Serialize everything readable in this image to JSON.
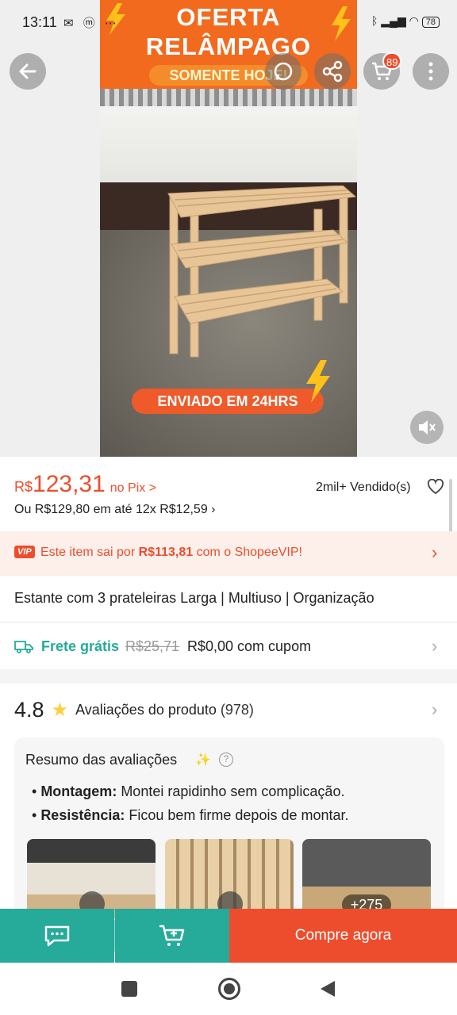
{
  "status_bar": {
    "time": "13:11",
    "battery": "78"
  },
  "media": {
    "banner_line1": "OFERTA",
    "banner_line2": "RELÂMPAGO",
    "banner_pill": "SOMENTE HOJE!",
    "shipping_tag": "ENVIADO EM 24HRS"
  },
  "header": {
    "cart_badge": "89"
  },
  "price": {
    "currency": "R$",
    "value": "123,31",
    "pix_label": "no Pix >",
    "installment": "Ou R$129,80 em até 12x R$12,59 ›",
    "sold": "2mil+ Vendido(s)"
  },
  "vip": {
    "tag": "VIP",
    "text_before": "Este item sai por ",
    "vip_price": "R$113,81",
    "text_after": " com o ShopeeVIP!"
  },
  "product": {
    "title": "Estante com 3 prateleiras Larga | Multiuso | Organização"
  },
  "shipping": {
    "label": "Frete grátis",
    "old_price": "R$25,71",
    "new_price": "R$0,00 com cupom"
  },
  "reviews": {
    "score": "4.8",
    "label": "Avaliações do produto",
    "count": "(978)",
    "summary_title": "Resumo das avaliações",
    "bullets": [
      {
        "key": "Montagem:",
        "text": " Montei rapidinho sem complicação."
      },
      {
        "key": "Resistência:",
        "text": " Ficou bem firme depois de montar."
      }
    ],
    "more_media": "+275"
  },
  "bottom_bar": {
    "buy_label": "Compre agora"
  },
  "colors": {
    "brand": "#ee4d2d",
    "teal": "#26aa99",
    "star": "#ffce3d"
  }
}
